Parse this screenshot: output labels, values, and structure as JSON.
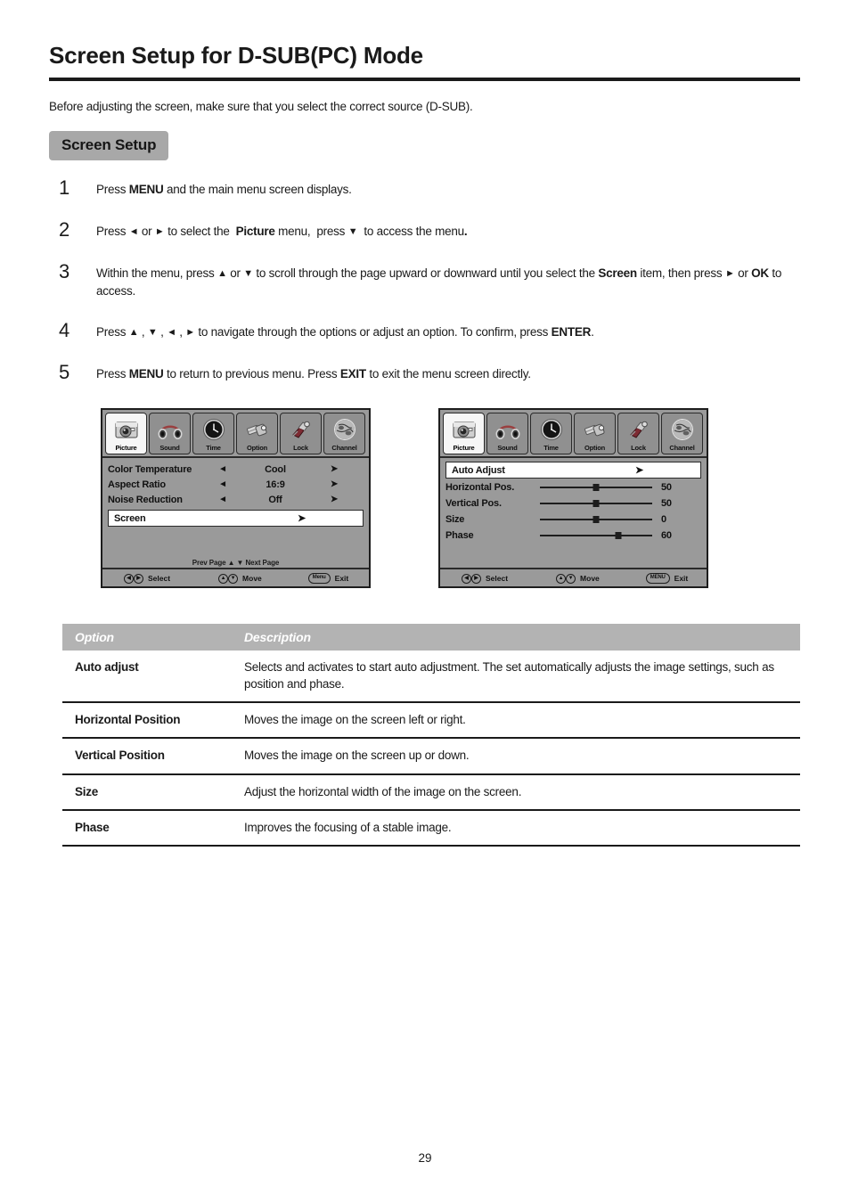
{
  "document": {
    "title": "Screen Setup for D-SUB(PC) Mode",
    "intro": "Before adjusting the screen, make sure that you select the correct source (D-SUB).",
    "section_badge": "Screen Setup",
    "page_number": "29"
  },
  "steps": [
    {
      "number": "1",
      "html": "Press <b>MENU</b> and the main menu screen displays."
    },
    {
      "number": "2",
      "html": "Press <span class=\"k\">&#9668;</span> or <span class=\"k\">&#9658;</span> to select the&nbsp; <b>Picture</b> menu,&nbsp; press <span class=\"k\">&#9660;</span>&nbsp; to access the menu<b>.</b>"
    },
    {
      "number": "3",
      "html": "Within the menu, press <span class=\"k\">&#9650;</span> or <span class=\"k\">&#9660;</span> to scroll through the page upward or downward until you select the <b>Screen</b> item, then press <span class=\"k\">&#9658;</span> or <b>OK</b> to access."
    },
    {
      "number": "4",
      "html": "Press <span class=\"k\">&#9650;</span> , <span class=\"k\">&#9660;</span> , <span class=\"k\">&#9668;</span> , <span class=\"k\">&#9658;</span> to navigate through the options or adjust an option. To confirm, press <b>ENTER</b>."
    },
    {
      "number": "5",
      "html": "Press <b>MENU</b> to return to previous menu. Press <b>EXIT</b> to exit the menu screen directly."
    }
  ],
  "osd_tabs": [
    {
      "label": "Picture",
      "icon": "camera-icon",
      "active": true
    },
    {
      "label": "Sound",
      "icon": "headphones-icon",
      "active": false
    },
    {
      "label": "Time",
      "icon": "clock-icon",
      "active": false
    },
    {
      "label": "Option",
      "icon": "connector-icon",
      "active": false
    },
    {
      "label": "Lock",
      "icon": "padlock-icon",
      "active": false
    },
    {
      "label": "Channel",
      "icon": "globe-icon",
      "active": false
    }
  ],
  "osd_picture_menu": {
    "rows": [
      {
        "label": "Color Temperature",
        "left_arrow": "◄",
        "value": "Cool",
        "right_arrow": "➤"
      },
      {
        "label": "Aspect Ratio",
        "left_arrow": "◄",
        "value": "16:9",
        "right_arrow": "➤"
      },
      {
        "label": "Noise Reduction",
        "left_arrow": "◄",
        "value": "Off",
        "right_arrow": "➤"
      }
    ],
    "highlighted_row": {
      "label": "Screen",
      "arrow": "➤"
    },
    "page_hint": "Prev  Page ▲   ▼ Next  Page",
    "footer": {
      "select_key_left": "◀",
      "select_key_right": "▶",
      "select_label": "Select",
      "move_key_up": "▲",
      "move_key_down": "▼",
      "move_label": "Move",
      "exit_key": "Menu",
      "exit_label": "Exit"
    }
  },
  "osd_screen_menu": {
    "highlighted_row": {
      "label": "Auto Adjust",
      "arrow": "➤"
    },
    "sliders": [
      {
        "label": "Horizontal Pos.",
        "value": "50",
        "percent": 50
      },
      {
        "label": "Vertical Pos.",
        "value": "50",
        "percent": 50
      },
      {
        "label": "Size",
        "value": "0",
        "percent": 50
      },
      {
        "label": "Phase",
        "value": "60",
        "percent": 70
      }
    ],
    "footer": {
      "select_key_left": "◀",
      "select_key_right": "▶",
      "select_label": "Select",
      "move_key_up": "▲",
      "move_key_down": "▼",
      "move_label": "Move",
      "exit_key": "MENU",
      "exit_label": "Exit"
    }
  },
  "option_table": {
    "headers": {
      "option": "Option",
      "description": "Description"
    },
    "rows": [
      {
        "option": "Auto adjust",
        "description": "Selects and activates to start auto adjustment. The set automatically adjusts the image settings, such as position and phase."
      },
      {
        "option": "Horizontal Position",
        "description": "Moves the image on the screen left or right."
      },
      {
        "option": "Vertical Position",
        "description": "Moves the image on the screen up or down."
      },
      {
        "option": "Size",
        "description": "Adjust the horizontal width of the image on the screen."
      },
      {
        "option": "Phase",
        "description": "Improves the focusing of a stable image."
      }
    ]
  },
  "colors": {
    "osd_background": "#9a9a9a",
    "osd_border": "#1d1d1d",
    "badge_background": "#a8a8a8",
    "table_header_background": "#b3b3b3",
    "text": "#1a1a1a"
  }
}
